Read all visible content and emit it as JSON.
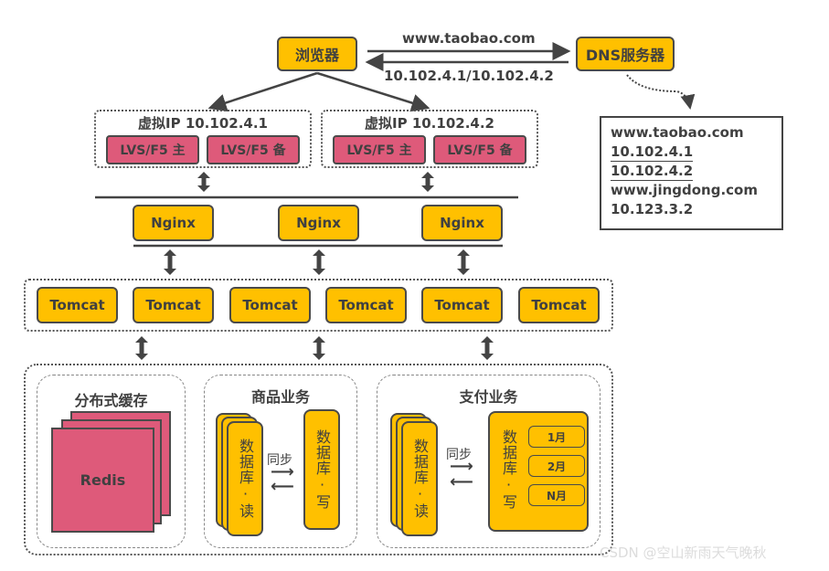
{
  "browser": {
    "label": "浏览器"
  },
  "dns": {
    "label": "DNS服务器",
    "request_label": "www.taobao.com",
    "response_label": "10.102.4.1/10.102.4.2",
    "table": [
      "www.taobao.com",
      "10.102.4.1",
      "10.102.4.2",
      "www.jingdong.com",
      "10.123.3.2"
    ]
  },
  "vip_groups": [
    {
      "title": "虚拟IP 10.102.4.1",
      "lvs": [
        "LVS/F5 主",
        "LVS/F5 备"
      ]
    },
    {
      "title": "虚拟IP 10.102.4.2",
      "lvs": [
        "LVS/F5 主",
        "LVS/F5 备"
      ]
    }
  ],
  "nginx": [
    "Nginx",
    "Nginx",
    "Nginx"
  ],
  "tomcat": [
    "Tomcat",
    "Tomcat",
    "Tomcat",
    "Tomcat",
    "Tomcat",
    "Tomcat"
  ],
  "cache": {
    "title": "分布式缓存",
    "node": "Redis"
  },
  "product": {
    "title": "商品业务",
    "read_db": "数据库·读",
    "write_db": "数据库·写",
    "sync": "同步"
  },
  "payment": {
    "title": "支付业务",
    "read_db": "数据库·读",
    "write_db": "数据库·写",
    "sync": "同步",
    "partitions": [
      "1月",
      "2月",
      "N月"
    ]
  },
  "watermark": "CSDN @空山新雨天气晚秋",
  "colors": {
    "yellow": "#ffc000",
    "pink": "#de5a7a",
    "stroke": "#4a4a4a"
  }
}
